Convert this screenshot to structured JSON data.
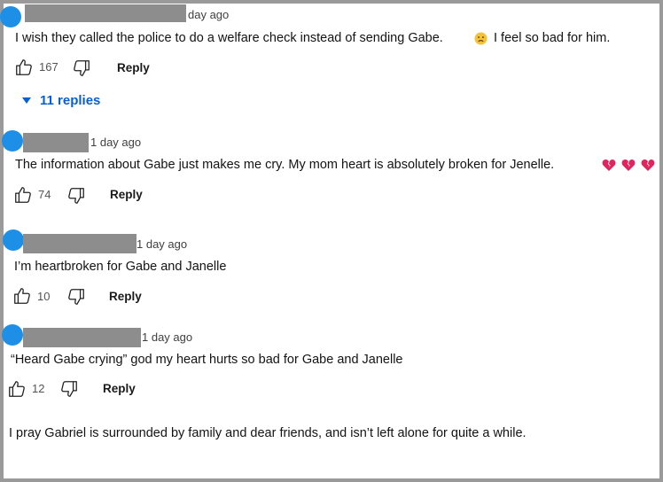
{
  "comments": [
    {
      "time": "day ago",
      "text": "I wish they called the police to do a welfare check instead of sending Gabe.",
      "text_after": "I feel so bad for him.",
      "likes": "167",
      "reply_label": "Reply",
      "replies_toggle": "11 replies"
    },
    {
      "time": "1 day ago",
      "text": "The information about Gabe just makes me cry.  My mom heart is absolutely broken for Jenelle.",
      "likes": "74",
      "reply_label": "Reply"
    },
    {
      "time": "1 day ago",
      "text": "I’m heartbroken for Gabe and Janelle",
      "likes": "10",
      "reply_label": "Reply"
    },
    {
      "time": "1 day ago",
      "text": "“Heard Gabe crying” god my heart hurts so bad for Gabe and Janelle",
      "likes": "12",
      "reply_label": "Reply"
    },
    {
      "text": "I pray Gabriel is surrounded by family and dear friends, and isn’t left alone for quite a while."
    }
  ],
  "colors": {
    "avatar": "#1e8fe6",
    "redaction": "#8d8d8d",
    "link_blue": "#065fd4",
    "broken_heart": "#e0245e",
    "sad_emoji": "#f5c33b"
  },
  "icons": [
    "thumbs-up-icon",
    "thumbs-down-icon",
    "chevron-down-icon",
    "sad-face-emoji",
    "broken-heart-emoji"
  ]
}
